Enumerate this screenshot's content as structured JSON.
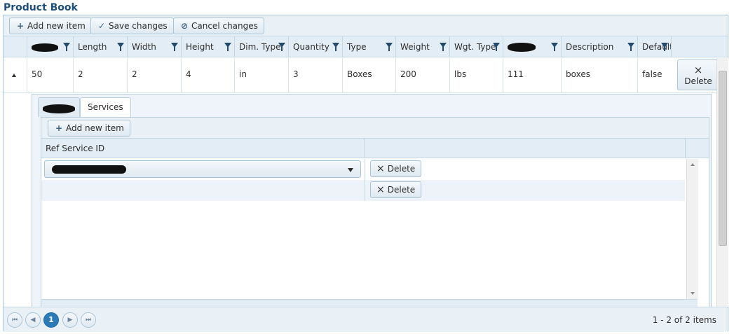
{
  "page_title": "Product Book",
  "toolbar": {
    "add_label": "Add new item",
    "save_label": "Save changes",
    "cancel_label": "Cancel changes"
  },
  "columns": [
    "Length",
    "Width",
    "Height",
    "Dim. Type",
    "Quantity",
    "Type",
    "Weight",
    "Wgt. Type",
    "Description",
    "Default"
  ],
  "row": {
    "col1": "50",
    "length": "2",
    "width": "2",
    "height": "4",
    "dim_type": "in",
    "quantity": "3",
    "type": "Boxes",
    "weight": "200",
    "wgt_type": "lbs",
    "col_redacted": "111",
    "description": "boxes",
    "default": "false",
    "delete_label": "Delete"
  },
  "detail": {
    "tab_services": "Services",
    "add_label": "Add new item",
    "col_ref_service": "Ref Service ID",
    "delete_label": "Delete"
  },
  "pager": {
    "current_page": "1",
    "info": "1 - 2 of 2 items"
  },
  "icons": {
    "plus": "+",
    "check": "✓",
    "cancel": "⊘",
    "close": "×",
    "first": "⏮",
    "prev": "◀",
    "next": "▶",
    "last": "⏭"
  }
}
